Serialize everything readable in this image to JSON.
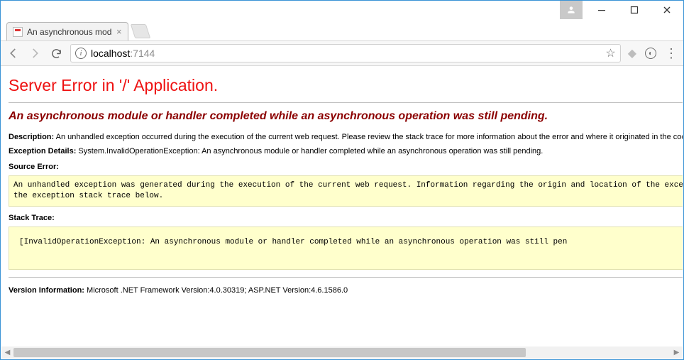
{
  "window": {
    "tab_title": "An asynchronous modul",
    "host": "localhost",
    "port": ":7144"
  },
  "page": {
    "title": "Server Error in '/' Application.",
    "subtitle": "An asynchronous module or handler completed while an asynchronous operation was still pending.",
    "description_label": "Description:",
    "description_text": "An unhandled exception occurred during the execution of the current web request. Please review the stack trace for more information about the error and where it originated in the code.",
    "exception_label": "Exception Details:",
    "exception_text": "System.InvalidOperationException: An asynchronous module or handler completed while an asynchronous operation was still pending.",
    "source_error_label": "Source Error:",
    "source_error_box": "An unhandled exception was generated during the execution of the current web request. Information regarding the origin and location of the exception can be identified using the exception stack trace below.",
    "stack_trace_label": "Stack Trace:",
    "stack_trace_box": "[InvalidOperationException: An asynchronous module or handler completed while an asynchronous operation was still pen",
    "version_label": "Version Information:",
    "version_text": "Microsoft .NET Framework Version:4.0.30319; ASP.NET Version:4.6.1586.0"
  }
}
